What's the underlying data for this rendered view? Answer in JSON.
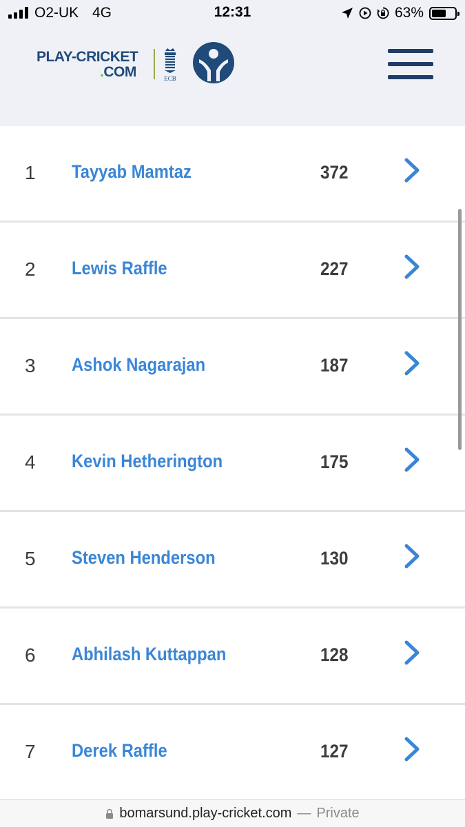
{
  "status_bar": {
    "carrier": "O2-UK",
    "network": "4G",
    "time": "12:31",
    "battery_percent": "63%",
    "battery_level": 0.63,
    "icons": [
      "signal-icon",
      "location-arrow-icon",
      "screen-record-icon",
      "orientation-lock-icon",
      "battery-icon"
    ]
  },
  "header": {
    "logo_line1": "PLAY-CRICKET",
    "logo_line2_dot": ".",
    "logo_line2": "COM",
    "ecb_label": "ECB",
    "menu_icon": "hamburger-menu-icon",
    "colors": {
      "navy": "#1f4a7a",
      "green": "#62b844",
      "menu": "#1f3d66"
    }
  },
  "list": {
    "rows": [
      {
        "rank": "1",
        "name": "Tayyab Mamtaz",
        "score": "372"
      },
      {
        "rank": "2",
        "name": "Lewis Raffle",
        "score": "227"
      },
      {
        "rank": "3",
        "name": "Ashok Nagarajan",
        "score": "187"
      },
      {
        "rank": "4",
        "name": "Kevin Hetherington",
        "score": "175"
      },
      {
        "rank": "5",
        "name": "Steven Henderson",
        "score": "130"
      },
      {
        "rank": "6",
        "name": "Abhilash Kuttappan",
        "score": "128"
      },
      {
        "rank": "7",
        "name": "Derek Raffle",
        "score": "127"
      }
    ],
    "row_icon": "chevron-right-icon",
    "colors": {
      "name": "#3a86d6",
      "text": "#3c3c3c",
      "chevron": "#3a86d6"
    }
  },
  "url_bar": {
    "domain": "bomarsund.play-cricket.com",
    "separator": "—",
    "mode": "Private"
  }
}
